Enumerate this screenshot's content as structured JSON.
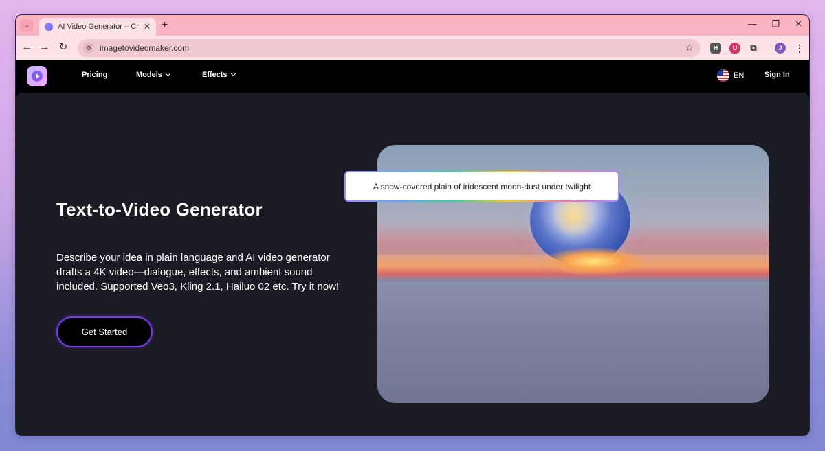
{
  "browser": {
    "tab_title": "AI Video Generator – Create Vid",
    "new_tab_label": "+",
    "url": "imagetovideomaker.com",
    "profile_initial": "J",
    "ext_h_label": "H",
    "ext_shield_label": "U"
  },
  "site_nav": {
    "pricing": "Pricing",
    "models": "Models",
    "effects": "Effects",
    "language": "EN",
    "sign_in": "Sign In"
  },
  "hero": {
    "title": "Text-to-Video Generator",
    "description": "Describe your idea in plain language and AI video generator drafts a 4K video—dialogue, effects, and ambient sound included. Supported Veo3, Kling 2.1, Hailuo 02 etc. Try it now!",
    "cta_label": "Get Started",
    "prompt_text": "A snow-covered plain of iridescent moon-dust under twilight"
  },
  "colors": {
    "accent": "#7c3aed",
    "tab_strip": "#fbb4c2",
    "hero_bg": "#1b1b24"
  }
}
